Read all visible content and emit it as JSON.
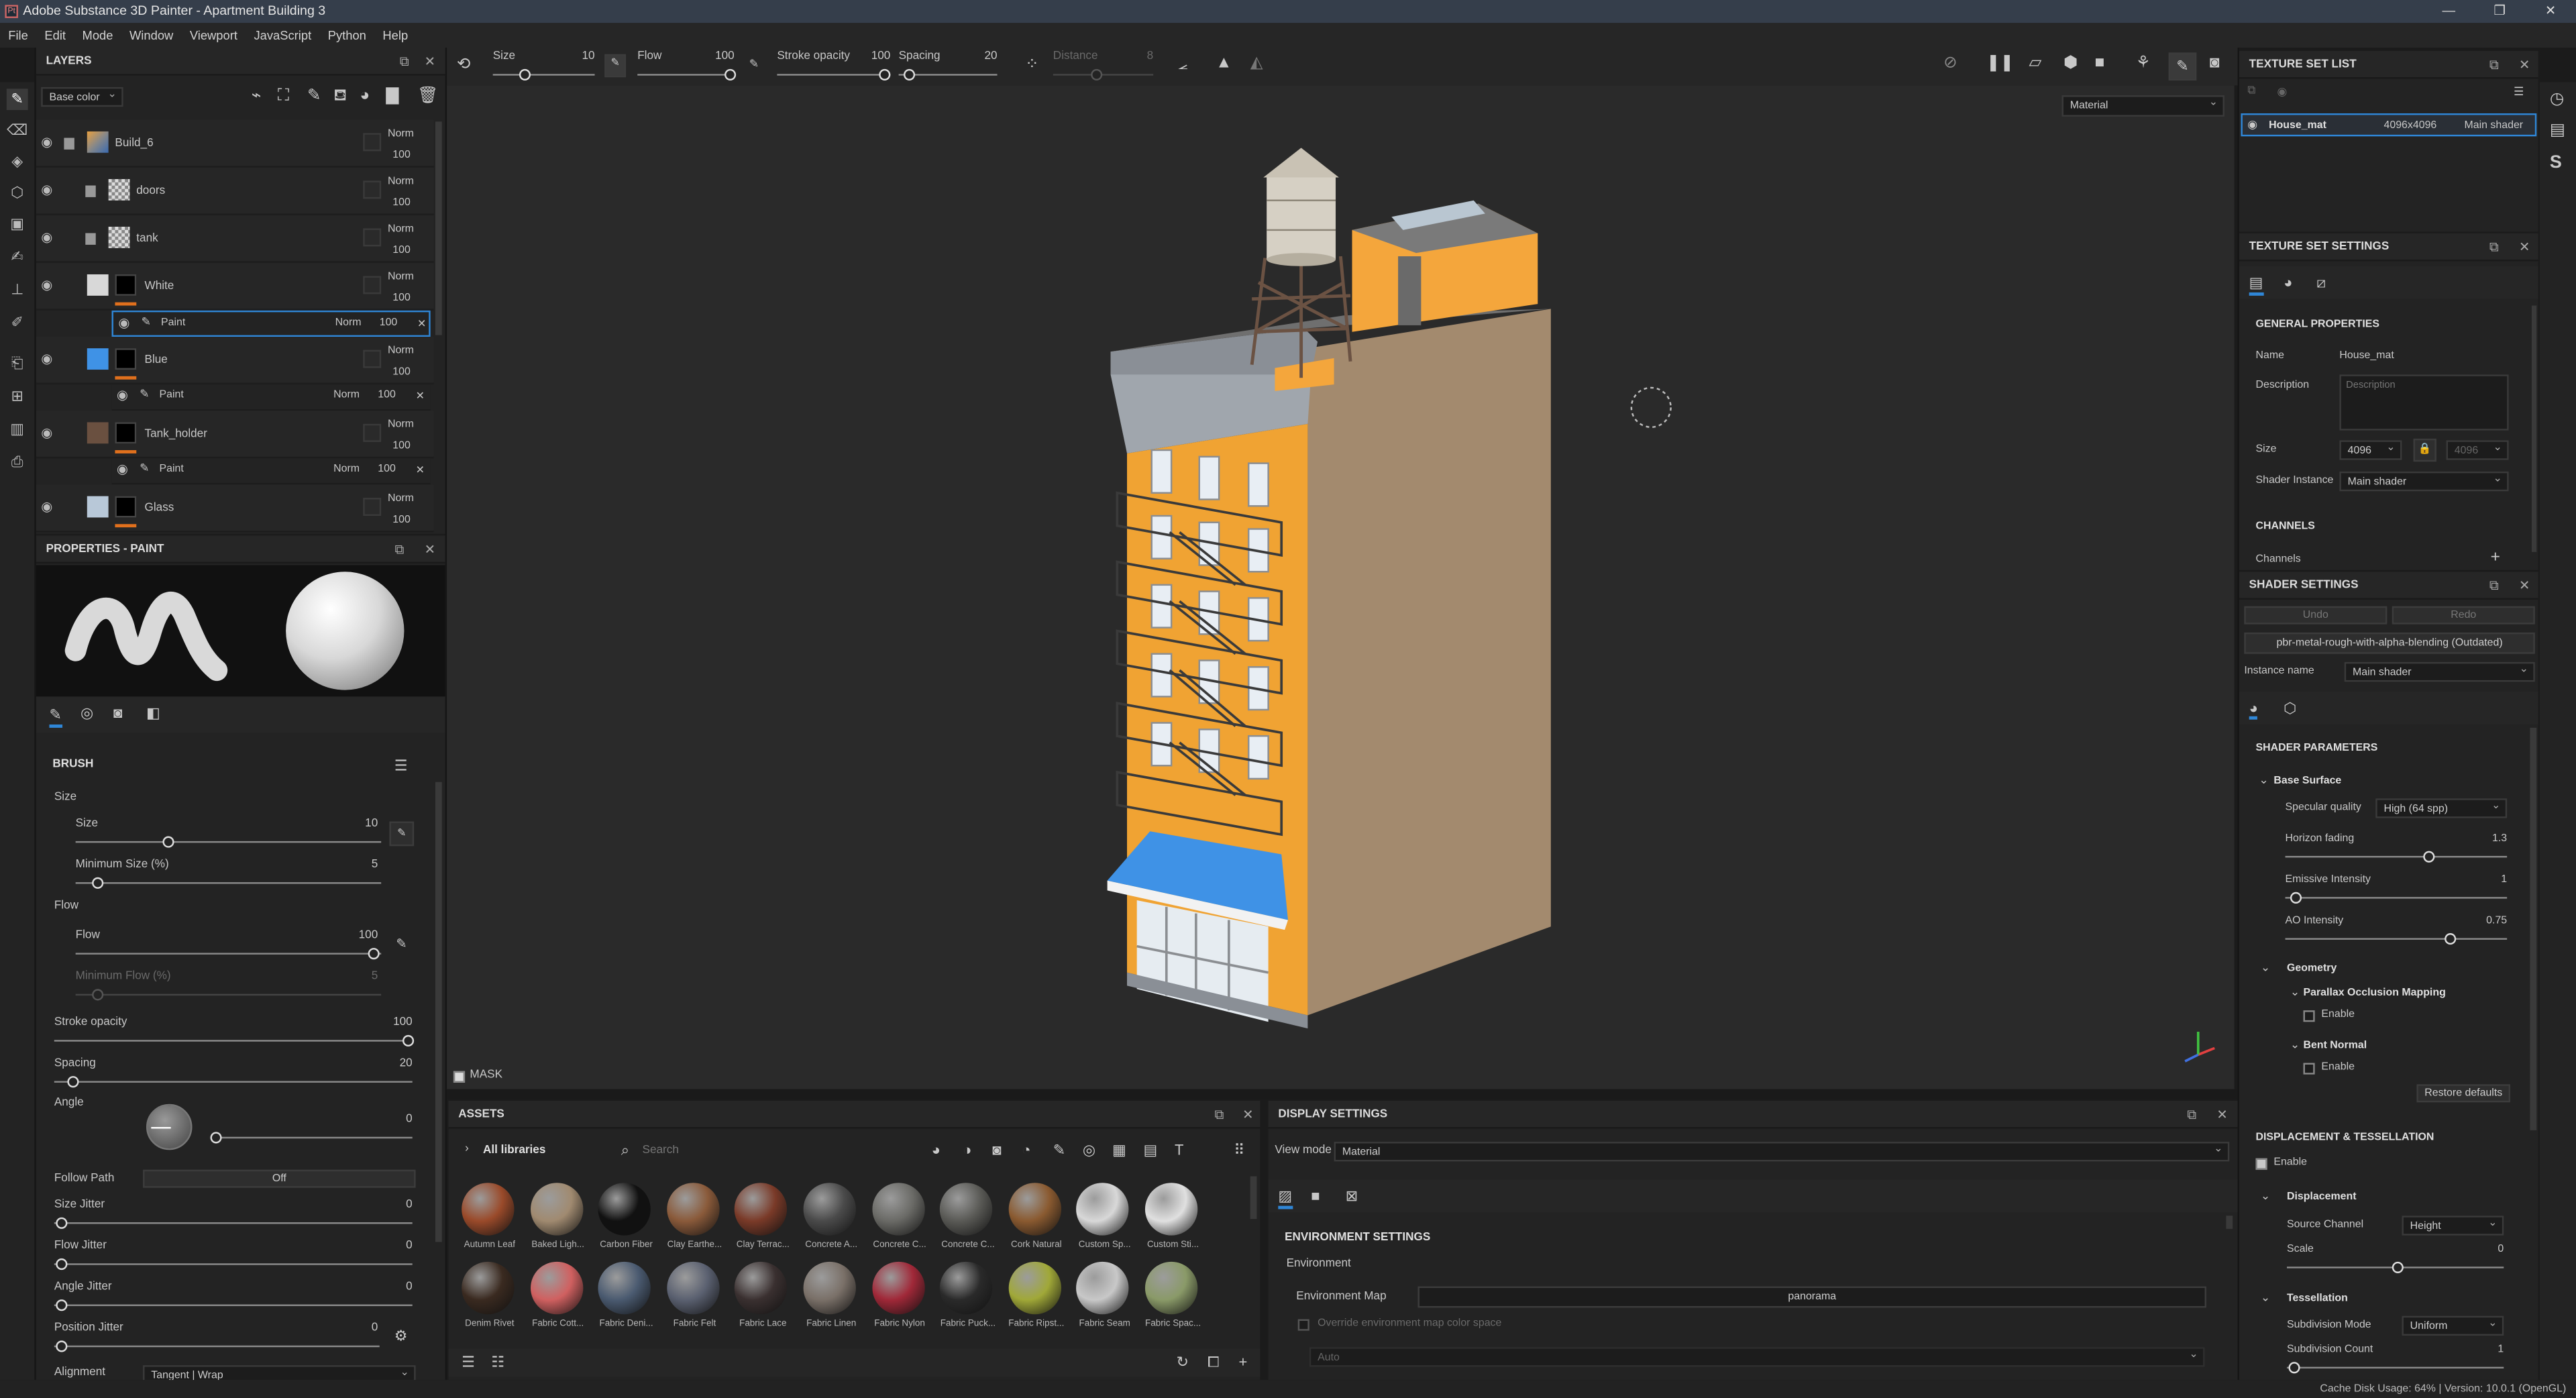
{
  "app": {
    "title": "Adobe Substance 3D Painter - Apartment Building 3",
    "logo_text": "Pt"
  },
  "window_buttons": [
    "—",
    "❐",
    "✕"
  ],
  "menu": [
    "File",
    "Edit",
    "Mode",
    "Window",
    "Viewport",
    "JavaScript",
    "Python",
    "Help"
  ],
  "layers": {
    "title": "LAYERS",
    "channel": "Base color",
    "rows": [
      {
        "name": "Build_6",
        "blend": "Norm",
        "opacity": "100"
      },
      {
        "name": "doors",
        "blend": "Norm",
        "opacity": "100"
      },
      {
        "name": "tank",
        "blend": "Norm",
        "opacity": "100"
      },
      {
        "name": "White",
        "blend": "Norm",
        "opacity": "100"
      },
      {
        "name": "Paint",
        "blend": "Norm",
        "opacity": "100"
      },
      {
        "name": "Blue",
        "blend": "Norm",
        "opacity": "100"
      },
      {
        "name": "Paint",
        "blend": "Norm",
        "opacity": "100"
      },
      {
        "name": "Tank_holder",
        "blend": "Norm",
        "opacity": "100"
      },
      {
        "name": "Paint",
        "blend": "Norm",
        "opacity": "100"
      },
      {
        "name": "Glass",
        "blend": "Norm",
        "opacity": "100"
      }
    ]
  },
  "properties": {
    "title": "PROPERTIES - PAINT",
    "brush_title": "BRUSH",
    "size_group": "Size",
    "size_label": "Size",
    "size_value": "10",
    "min_size_label": "Minimum Size (%)",
    "min_size_value": "5",
    "flow_group": "Flow",
    "flow_label": "Flow",
    "flow_value": "100",
    "min_flow_label": "Minimum Flow (%)",
    "min_flow_value": "5",
    "stroke_opacity_label": "Stroke opacity",
    "stroke_opacity_value": "100",
    "spacing_label": "Spacing",
    "spacing_value": "20",
    "angle_label": "Angle",
    "angle_value": "0",
    "follow_path_label": "Follow Path",
    "follow_path_value": "Off",
    "size_jitter_label": "Size Jitter",
    "size_jitter_value": "0",
    "flow_jitter_label": "Flow Jitter",
    "flow_jitter_value": "0",
    "angle_jitter_label": "Angle Jitter",
    "angle_jitter_value": "0",
    "position_jitter_label": "Position Jitter",
    "position_jitter_value": "0",
    "alignment_label": "Alignment",
    "alignment_value": "Tangent | Wrap"
  },
  "toolbar": {
    "size_label": "Size",
    "size_value": "10",
    "flow_label": "Flow",
    "flow_value": "100",
    "stroke_opacity_label": "Stroke opacity",
    "stroke_opacity_value": "100",
    "spacing_label": "Spacing",
    "spacing_value": "20",
    "distance_label": "Distance",
    "distance_value": "8"
  },
  "viewport": {
    "mode": "Material",
    "mask_label": "MASK"
  },
  "assets": {
    "title": "ASSETS",
    "library": "All libraries",
    "search_placeholder": "Search",
    "items": [
      {
        "name": "Autumn Leaf",
        "color": "#9a4a2a"
      },
      {
        "name": "Baked Ligh...",
        "color": "#a08a70"
      },
      {
        "name": "Carbon Fiber",
        "color": "#111111"
      },
      {
        "name": "Clay Earthe...",
        "color": "#8a5a3a"
      },
      {
        "name": "Clay Terrac...",
        "color": "#7a3a28"
      },
      {
        "name": "Concrete A...",
        "color": "#4a4a4a"
      },
      {
        "name": "Concrete C...",
        "color": "#6a6a66"
      },
      {
        "name": "Concrete C...",
        "color": "#5a5a56"
      },
      {
        "name": "Cork Natural",
        "color": "#8a5a30"
      },
      {
        "name": "Custom Sp...",
        "color": "#d8d8d8"
      },
      {
        "name": "Custom Sti...",
        "color": "#e0e0e0"
      },
      {
        "name": "Denim Rivet",
        "color": "#3a2a20"
      },
      {
        "name": "Fabric Cott...",
        "color": "#d06060"
      },
      {
        "name": "Fabric Deni...",
        "color": "#4a5a70"
      },
      {
        "name": "Fabric Felt",
        "color": "#5a6070"
      },
      {
        "name": "Fabric Lace",
        "color": "#3a3030"
      },
      {
        "name": "Fabric Linen",
        "color": "#7a7068"
      },
      {
        "name": "Fabric Nylon",
        "color": "#a02838"
      },
      {
        "name": "Fabric Puck...",
        "color": "#2a2a2a"
      },
      {
        "name": "Fabric Ripst...",
        "color": "#a0a838"
      },
      {
        "name": "Fabric Seam",
        "color": "#c8c8c8"
      },
      {
        "name": "Fabric Spac...",
        "color": "#8a9a68"
      }
    ]
  },
  "display_settings": {
    "title": "DISPLAY SETTINGS",
    "view_mode_label": "View mode",
    "view_mode_value": "Material",
    "env_title": "ENVIRONMENT SETTINGS",
    "env_label": "Environment",
    "env_map_label": "Environment Map",
    "env_map_value": "panorama",
    "override_label": "Override environment map color space",
    "auto_value": "Auto"
  },
  "texture_set_list": {
    "title": "TEXTURE SET LIST",
    "item": {
      "name": "House_mat",
      "size": "4096x4096",
      "shader": "Main shader"
    }
  },
  "texture_set_settings": {
    "title": "TEXTURE SET SETTINGS",
    "general_title": "GENERAL PROPERTIES",
    "name_label": "Name",
    "name_value": "House_mat",
    "description_label": "Description",
    "description_placeholder": "Description",
    "size_label": "Size",
    "size_value": "4096",
    "size_value2": "4096",
    "shader_instance_label": "Shader Instance",
    "shader_instance_value": "Main shader",
    "channels_title": "CHANNELS",
    "channels_label": "Channels"
  },
  "shader_settings": {
    "title": "SHADER SETTINGS",
    "undo": "Undo",
    "redo": "Redo",
    "shader_name": "pbr-metal-rough-with-alpha-blending (Outdated)",
    "instance_name_label": "Instance name",
    "instance_name_value": "Main shader",
    "params_title": "SHADER PARAMETERS",
    "base_surface": "Base Surface",
    "specular_label": "Specular quality",
    "specular_value": "High (64 spp)",
    "horizon_label": "Horizon fading",
    "horizon_value": "1.3",
    "emissive_label": "Emissive Intensity",
    "emissive_value": "1",
    "ao_label": "AO Intensity",
    "ao_value": "0.75",
    "geometry": "Geometry",
    "pom": "Parallax Occlusion Mapping",
    "enable1": "Enable",
    "bent_normal": "Bent Normal",
    "enable2": "Enable",
    "restore_defaults": "Restore defaults",
    "disp_title": "DISPLACEMENT & TESSELLATION",
    "disp_enable": "Enable",
    "displacement": "Displacement",
    "source_channel_label": "Source Channel",
    "source_channel_value": "Height",
    "scale_label": "Scale",
    "scale_value": "0",
    "tessellation": "Tessellation",
    "subdiv_mode_label": "Subdivision Mode",
    "subdiv_mode_value": "Uniform",
    "subdiv_count_label": "Subdivision Count",
    "subdiv_count_value": "1"
  },
  "statusbar": {
    "text": "Cache Disk Usage:   64%  |  Version: 10.0.1 (OpenGL)"
  },
  "colors": {
    "accent": "#e0701d",
    "selection": "#2f86d6",
    "building_orange": "#f2a53a",
    "awning_blue": "#3f92e6"
  }
}
